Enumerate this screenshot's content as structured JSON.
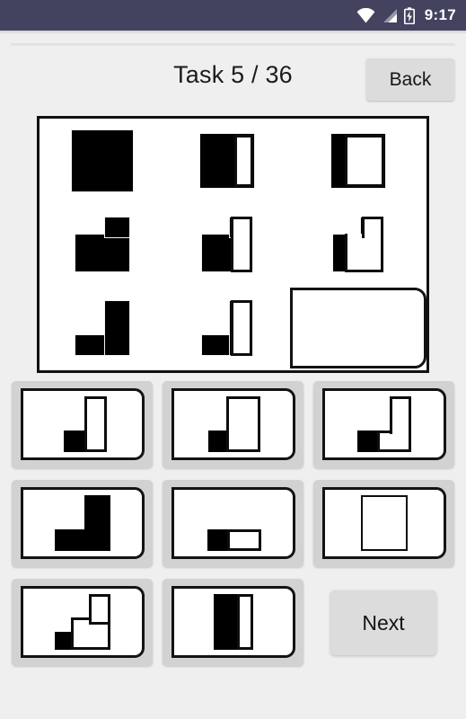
{
  "statusbar": {
    "time": "9:17",
    "icons": [
      "wifi-icon",
      "cellular-signal-icon",
      "battery-charging-icon"
    ],
    "background_color": "#434360"
  },
  "header": {
    "title": "Task 5 / 36",
    "task_number": 5,
    "task_total": 36,
    "back_label": "Back"
  },
  "matrix": {
    "rows": 3,
    "columns": 3,
    "cells": [
      {
        "position": "r1c1",
        "description": "solid black square"
      },
      {
        "position": "r1c2",
        "description": "black square with white vertical strip on right"
      },
      {
        "position": "r1c3",
        "description": "narrow black vertical strip on left with large white square on right"
      },
      {
        "position": "r2c1",
        "description": "black step shape, notch removed from top-left"
      },
      {
        "position": "r2c2",
        "description": "black step shape with white vertical strip on right"
      },
      {
        "position": "r2c3",
        "description": "narrow black strip on lower left with white step shape"
      },
      {
        "position": "r3c1",
        "description": "black L shape, bottom bar and right column"
      },
      {
        "position": "r3c2",
        "description": "black L shape with white vertical strip on right"
      },
      {
        "position": "r3c3",
        "description": "empty answer placeholder"
      }
    ],
    "answer_slot_label": "empty"
  },
  "options": [
    {
      "index": 1,
      "description": "small black square bottom-left with tall narrow white column"
    },
    {
      "index": 2,
      "description": "small black square bottom-left with large white rectangle"
    },
    {
      "index": 3,
      "description": "small black square bottom-left with white L shape"
    },
    {
      "index": 4,
      "description": "solid black L shape"
    },
    {
      "index": 5,
      "description": "small black square with horizontal white rectangle"
    },
    {
      "index": 6,
      "description": "plain white square outline"
    },
    {
      "index": 7,
      "description": "small black square with white staircase shape"
    },
    {
      "index": 8,
      "description": "black vertical bar with white vertical strip on right"
    }
  ],
  "footer": {
    "next_label": "Next"
  },
  "colors": {
    "statusbar": "#434360",
    "page_background": "#efefef",
    "tile_background": "#d2d2d2",
    "button_background": "#dcdcdc",
    "stroke": "#111111",
    "fill": "#000000"
  }
}
